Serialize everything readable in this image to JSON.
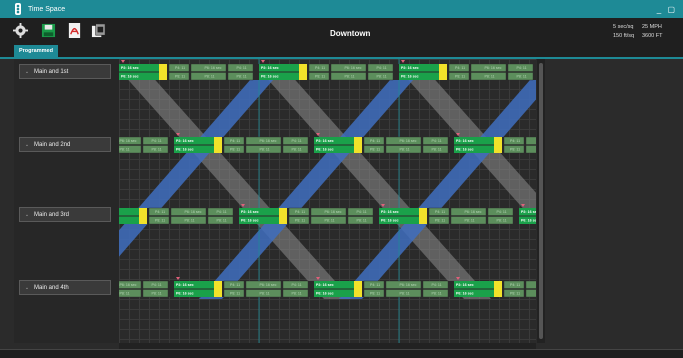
{
  "window": {
    "title": "Time Space",
    "controls": "_ ▢"
  },
  "toolbar": {
    "icons": [
      "gear-icon",
      "save-icon",
      "pdf-icon",
      "export-icon"
    ]
  },
  "header": {
    "title": "Downtown"
  },
  "stats": {
    "speed_time": "5 sec/sq",
    "speed": "25 MPH",
    "distance_scale": "150 ft/sq",
    "distance": "3600 FT"
  },
  "tabs": [
    {
      "label": "Programmed"
    }
  ],
  "intersections": [
    {
      "name": "Main and 1st"
    },
    {
      "name": "Main and 2nd"
    },
    {
      "name": "Main and 3rd"
    },
    {
      "name": "Main and 4th"
    }
  ],
  "phase_labels": {
    "p2": "P2: 16 sec",
    "p6": "P6: 16 sec",
    "p4": "P4: 11",
    "p8": "P8: 11",
    "p_mid": "P6: 16 sec"
  },
  "colors": {
    "accent": "#1e8a96",
    "green": "#1aa14a",
    "yellow": "#f2e22a",
    "band_blue": "#3f6fbf",
    "band_gray": "#8c8c8c",
    "marker": "#e0607a"
  }
}
